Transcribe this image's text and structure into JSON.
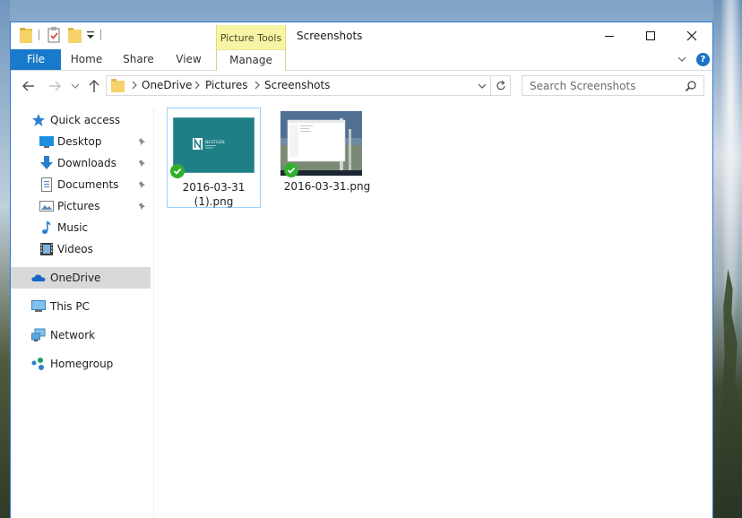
{
  "window": {
    "title": "Screenshots",
    "context_tab_group": "Picture Tools"
  },
  "ribbon": {
    "tabs": [
      "File",
      "Home",
      "Share",
      "View",
      "Manage"
    ]
  },
  "address": {
    "breadcrumb": [
      "OneDrive",
      "Pictures",
      "Screenshots"
    ],
    "search_placeholder": "Search Screenshots"
  },
  "nav": {
    "quick_access": "Quick access",
    "items": [
      "Desktop",
      "Downloads",
      "Documents",
      "Pictures",
      "Music",
      "Videos"
    ],
    "onedrive": "OneDrive",
    "this_pc": "This PC",
    "network": "Network",
    "homegroup": "Homegroup"
  },
  "files": [
    {
      "line1": "2016-03-31",
      "line2": "(1).png",
      "sync_status": "synced"
    },
    {
      "line1": "2016-03-31.png",
      "line2": "",
      "sync_status": "synced"
    }
  ],
  "thumb1_brand": "NEXTGEN",
  "colors": {
    "accent": "#1979ca",
    "context_tab": "#f7f4a6",
    "selection": "#d9d9d9",
    "sync_ok": "#30b12c"
  }
}
